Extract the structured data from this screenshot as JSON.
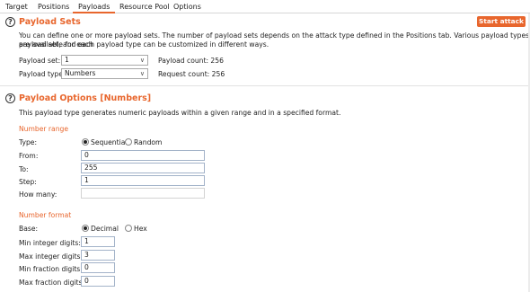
{
  "tabs": [
    "Target",
    "Positions",
    "Payloads",
    "Resource Pool",
    "Options"
  ],
  "payload_sets": {
    "title": "Payload Sets",
    "start_attack": "Start attack",
    "desc_line1": "You can define one or more payload sets. The number of payload sets depends on the attack type defined in the Positions tab. Various payload types are available for each",
    "desc_line2": "payload set, and each payload type can be customized in different ways.",
    "set_label": "Payload set:",
    "set_value": "1",
    "type_label": "Payload type:",
    "type_value": "Numbers",
    "count": "Payload count: 256",
    "request": "Request count: 256"
  },
  "payload_options": {
    "title": "Payload Options [Numbers]",
    "desc": "This payload type generates numeric payloads within a given range and in a specified format.",
    "range_title": "Number range",
    "type_label": "Type:",
    "sequential": "Sequential",
    "random": "Random",
    "from_label": "From:",
    "from_value": "0",
    "to_label": "To:",
    "to_value": "255",
    "step_label": "Step:",
    "step_value": "1",
    "howmany_label": "How many:",
    "howmany_value": "",
    "format_title": "Number format",
    "base_label": "Base:",
    "decimal": "Decimal",
    "hex": "Hex",
    "min_int_label": "Min integer digits:",
    "min_int_value": "1",
    "max_int_label": "Max integer digits:",
    "max_int_value": "3",
    "min_frac_label": "Min fraction digits:",
    "min_frac_value": "0",
    "max_frac_label": "Max fraction digits:",
    "max_frac_value": "0"
  },
  "icons": {
    "help": "?",
    "chevron": "∨"
  },
  "colors": {
    "accent": "#e8662d"
  }
}
